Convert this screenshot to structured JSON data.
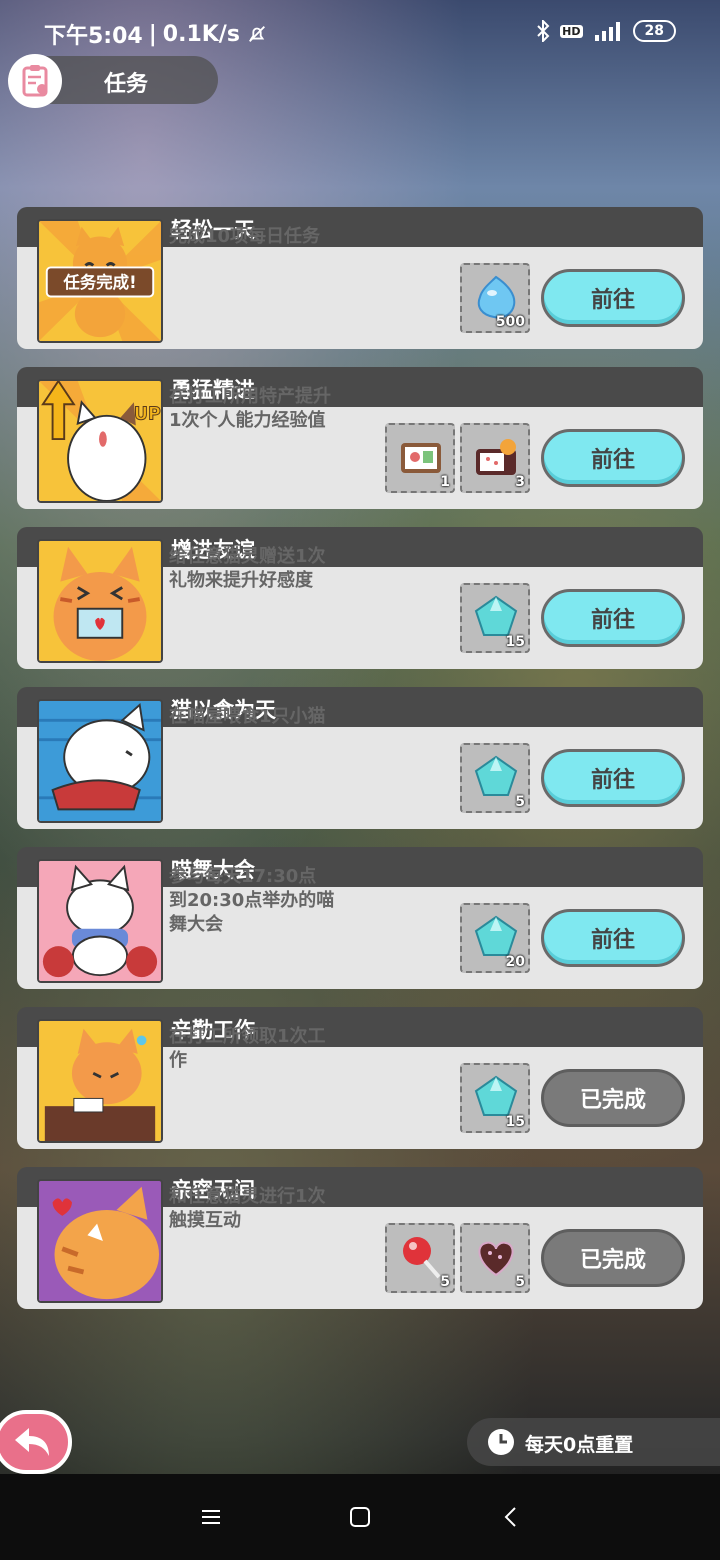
{
  "status_bar": {
    "time": "下午5:04",
    "speed": "0.1K/s",
    "battery": "28"
  },
  "header": {
    "title": "任务"
  },
  "tasks": [
    {
      "title": "轻松一天",
      "desc": "完成10项每日任务",
      "rewards": [
        {
          "icon": "blue-slime-icon",
          "count": "500"
        }
      ],
      "button": "前往",
      "done": false,
      "thumb_text": "任务完成!"
    },
    {
      "title": "勇猛精进",
      "desc": "在打工所用特产提升\n1次个人能力经验值",
      "rewards": [
        {
          "icon": "bento-box-icon",
          "count": "1"
        },
        {
          "icon": "gift-box-icon",
          "count": "3"
        }
      ],
      "button": "前往",
      "done": false,
      "thumb_text": "UP"
    },
    {
      "title": "增进友谊",
      "desc": "给任意猫灵赠送1次\n礼物来提升好感度",
      "rewards": [
        {
          "icon": "gem-icon",
          "count": "15"
        }
      ],
      "button": "前往",
      "done": false
    },
    {
      "title": "猫以食为天",
      "desc": "在喵屋喂食1只小猫",
      "rewards": [
        {
          "icon": "gem-icon",
          "count": "5"
        }
      ],
      "button": "前往",
      "done": false
    },
    {
      "title": "喵舞大会",
      "desc": "参与每天17:30点\n到20:30点举办的喵\n舞大会",
      "rewards": [
        {
          "icon": "gem-icon",
          "count": "20"
        }
      ],
      "button": "前往",
      "done": false
    },
    {
      "title": "辛勤工作",
      "desc": "在打工所领取1次工\n作",
      "rewards": [
        {
          "icon": "gem-icon",
          "count": "15"
        }
      ],
      "button": "已完成",
      "done": true
    },
    {
      "title": "亲密无间",
      "desc": "和任意猫灵进行1次\n触摸互动",
      "rewards": [
        {
          "icon": "lollipop-icon",
          "count": "5"
        },
        {
          "icon": "heart-chocolate-icon",
          "count": "5"
        }
      ],
      "button": "已完成",
      "done": true
    }
  ],
  "reset_notice": "每天0点重置",
  "colors": {
    "go_button": "#7fe8f0",
    "done_button": "#7a7a7a",
    "task_header": "#4a4a4a",
    "task_body": "#e6e6e6"
  }
}
